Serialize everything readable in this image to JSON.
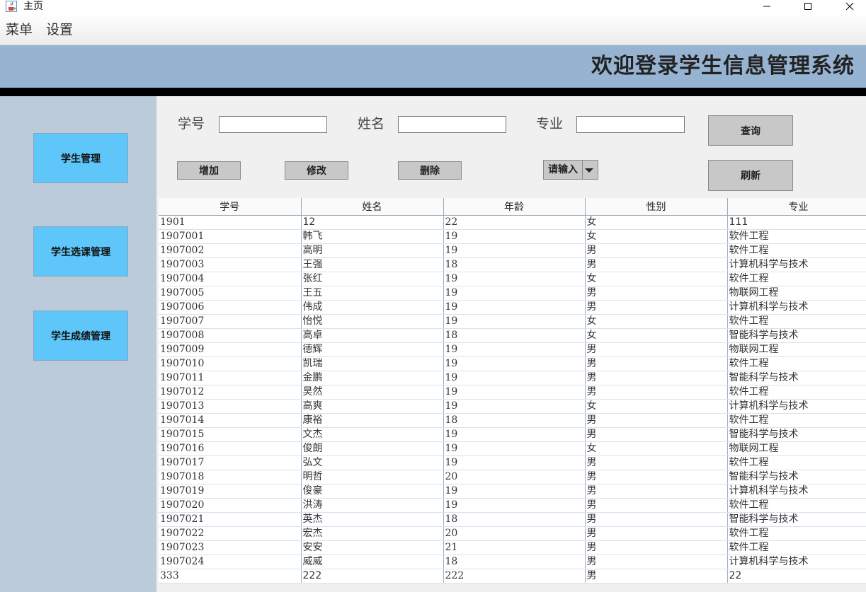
{
  "window": {
    "title": "主页",
    "app_icon": "java-cup-icon"
  },
  "menubar": {
    "items": [
      "菜单",
      "设置"
    ]
  },
  "banner": {
    "title": "欢迎登录学生信息管理系统"
  },
  "sidebar": {
    "items": [
      "学生管理",
      "学生选课管理",
      "学生成绩管理"
    ]
  },
  "search": {
    "id_label": "学号",
    "id_value": "",
    "name_label": "姓名",
    "name_value": "",
    "major_label": "专业",
    "major_value": "",
    "query_button": "查询"
  },
  "actions": {
    "add": "增加",
    "edit": "修改",
    "delete": "删除",
    "combo_value": "请输入",
    "refresh": "刷新"
  },
  "table": {
    "headers": [
      "学号",
      "姓名",
      "年龄",
      "性别",
      "专业"
    ],
    "rows": [
      [
        "1901",
        "12",
        "22",
        "女",
        "111"
      ],
      [
        "1907001",
        "韩飞",
        "19",
        "女",
        "软件工程"
      ],
      [
        "1907002",
        "高明",
        "19",
        "男",
        "软件工程"
      ],
      [
        "1907003",
        "王强",
        "18",
        "男",
        "计算机科学与技术"
      ],
      [
        "1907004",
        "张红",
        "19",
        "女",
        "软件工程"
      ],
      [
        "1907005",
        "王五",
        "19",
        "男",
        "物联网工程"
      ],
      [
        "1907006",
        "伟成",
        "19",
        "男",
        "计算机科学与技术"
      ],
      [
        "1907007",
        "怡悦",
        "19",
        "女",
        "软件工程"
      ],
      [
        "1907008",
        "高卓",
        "18",
        "女",
        "智能科学与技术"
      ],
      [
        "1907009",
        "德辉",
        "19",
        "男",
        "物联网工程"
      ],
      [
        "1907010",
        "凯瑞",
        "19",
        "男",
        "软件工程"
      ],
      [
        "1907011",
        "金鹏",
        "19",
        "男",
        "智能科学与技术"
      ],
      [
        "1907012",
        "昊然",
        "19",
        "男",
        "软件工程"
      ],
      [
        "1907013",
        "高爽",
        "19",
        "女",
        "计算机科学与技术"
      ],
      [
        "1907014",
        "康裕",
        "18",
        "男",
        "软件工程"
      ],
      [
        "1907015",
        "文杰",
        "19",
        "男",
        "智能科学与技术"
      ],
      [
        "1907016",
        "俊朗",
        "19",
        "女",
        "物联网工程"
      ],
      [
        "1907017",
        "弘文",
        "19",
        "男",
        "软件工程"
      ],
      [
        "1907018",
        "明哲",
        "20",
        "男",
        "智能科学与技术"
      ],
      [
        "1907019",
        "俊豪",
        "19",
        "男",
        "计算机科学与技术"
      ],
      [
        "1907020",
        "洪涛",
        "19",
        "男",
        "软件工程"
      ],
      [
        "1907021",
        "英杰",
        "18",
        "男",
        "智能科学与技术"
      ],
      [
        "1907022",
        "宏杰",
        "20",
        "男",
        "软件工程"
      ],
      [
        "1907023",
        "安安",
        "21",
        "男",
        "软件工程"
      ],
      [
        "1907024",
        "威威",
        "18",
        "男",
        "计算机科学与技术"
      ],
      [
        "333",
        "222",
        "222",
        "男",
        "22"
      ]
    ]
  }
}
